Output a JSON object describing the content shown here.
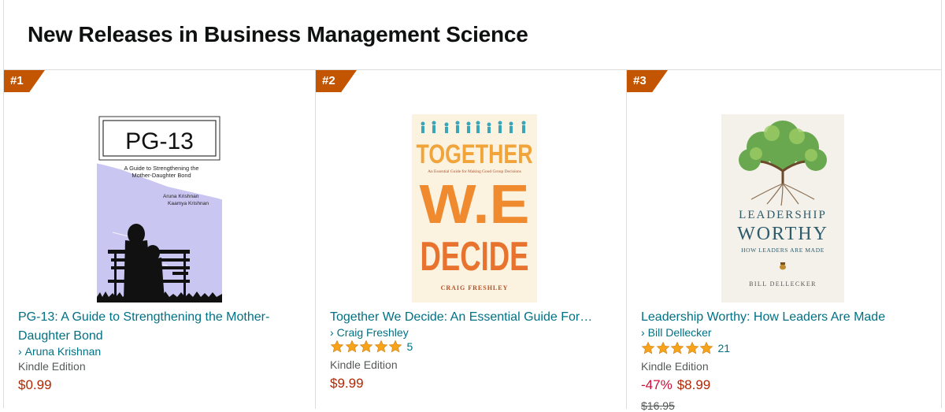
{
  "heading": "New Releases in Business Management Science",
  "items": [
    {
      "rank": "#1",
      "title": "PG-13: A Guide to Strengthening the Mother-Daughter Bond",
      "author": "Aruna Krishnan",
      "format": "Kindle Edition",
      "price": "$0.99",
      "cover": {
        "big_title": "PG-13",
        "subtitle_line1": "A Guide to Strengthening the",
        "subtitle_line2": "Mother-Daughter Bond",
        "author1": "Aruna Krishnan",
        "author2": "Kaamya Krishnan"
      }
    },
    {
      "rank": "#2",
      "title": "Together We Decide: An Essential Guide For…",
      "author": "Craig Freshley",
      "rating_stars": 5,
      "rating_count": "5",
      "format": "Kindle Edition",
      "price": "$9.99",
      "cover": {
        "line1": "TOGETHER",
        "tagline": "An Essential Guide for Making Good Group Decisions",
        "line2": "W.E",
        "line3": "DECIDE",
        "author": "CRAIG FRESHLEY"
      }
    },
    {
      "rank": "#3",
      "title": "Leadership Worthy: How Leaders Are Made",
      "author": "Bill Dellecker",
      "rating_stars": 5,
      "rating_count": "21",
      "format": "Kindle Edition",
      "discount": "-47%",
      "price": "$8.99",
      "list_price": "$16.95",
      "cover": {
        "line1": "LEADERSHIP",
        "line2": "WORTHY",
        "subtitle": "HOW LEADERS ARE MADE",
        "author": "BILL DELLECKER"
      }
    }
  ],
  "colors": {
    "link": "#007185",
    "price": "#b12704",
    "rank_badge": "#c45500",
    "star": "#f7a31c",
    "discount": "#cc0c39"
  },
  "icons": {
    "author_chevron": "chevron-right-icon",
    "rating_star": "star-icon"
  }
}
